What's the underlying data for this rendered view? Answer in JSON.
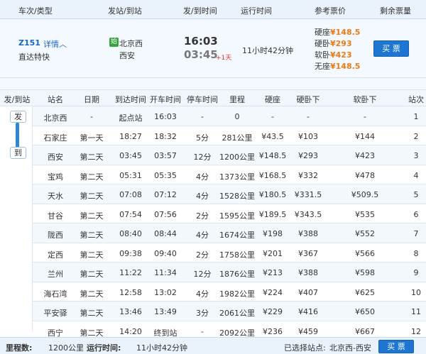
{
  "header": {
    "col_train": "车次/类型",
    "col_station": "发站/到站",
    "col_time": "发/到时间",
    "col_duration": "运行时间",
    "col_price": "参考票价",
    "col_remaining": "剩余票量"
  },
  "train": {
    "code": "Z151",
    "detail_link": "详情",
    "type": "直达特快",
    "start_badge": "始",
    "from_station": "北京西",
    "to_station": "西安",
    "depart_time": "16:03",
    "arrive_time": "03:45",
    "day_offset": "+1天",
    "duration": "11小时42分钟",
    "prices": [
      {
        "label": "硬座",
        "value": "¥148.5"
      },
      {
        "label": "硬卧",
        "value": "¥293"
      },
      {
        "label": "软卧",
        "value": "¥423"
      },
      {
        "label": "无座",
        "value": "¥148.5"
      }
    ],
    "buy_label": "买 票"
  },
  "table": {
    "headers": [
      "发/到站",
      "站名",
      "日期",
      "到达时间",
      "开车时间",
      "停车时间",
      "里程",
      "硬座",
      "硬卧下",
      "软卧下",
      "站次"
    ],
    "tag_depart": "发",
    "tag_arrive": "到",
    "rows": [
      [
        "北京西",
        "-",
        "起点站",
        "16:03",
        "-",
        "0",
        "-",
        "-",
        "-",
        "1"
      ],
      [
        "石家庄",
        "第一天",
        "18:27",
        "18:32",
        "5分",
        "281公里",
        "¥43.5",
        "¥103",
        "¥144",
        "2"
      ],
      [
        "西安",
        "第二天",
        "03:45",
        "03:57",
        "12分",
        "1200公里",
        "¥148.5",
        "¥293",
        "¥423",
        "3"
      ],
      [
        "宝鸡",
        "第二天",
        "05:31",
        "05:35",
        "4分",
        "1373公里",
        "¥168.5",
        "¥332",
        "¥478",
        "4"
      ],
      [
        "天水",
        "第二天",
        "07:08",
        "07:12",
        "4分",
        "1528公里",
        "¥180.5",
        "¥331.5",
        "¥509.5",
        "5"
      ],
      [
        "甘谷",
        "第二天",
        "07:54",
        "07:56",
        "2分",
        "1595公里",
        "¥189.5",
        "¥343.5",
        "¥535",
        "6"
      ],
      [
        "陇西",
        "第二天",
        "08:40",
        "08:44",
        "4分",
        "1674公里",
        "¥198",
        "¥388",
        "¥552",
        "7"
      ],
      [
        "定西",
        "第二天",
        "09:38",
        "09:40",
        "2分",
        "1758公里",
        "¥201",
        "¥367",
        "¥566",
        "8"
      ],
      [
        "兰州",
        "第二天",
        "11:22",
        "11:34",
        "12分",
        "1876公里",
        "¥213",
        "¥388",
        "¥598",
        "9"
      ],
      [
        "海石湾",
        "第二天",
        "12:58",
        "13:02",
        "4分",
        "1982公里",
        "¥224",
        "¥407",
        "¥625",
        "10"
      ],
      [
        "平安驿",
        "第二天",
        "13:46",
        "13:49",
        "3分",
        "2061公里",
        "¥229",
        "¥416",
        "¥650",
        "11"
      ],
      [
        "西宁",
        "第二天",
        "14:20",
        "终到站",
        "-",
        "2092公里",
        "¥236",
        "¥459",
        "¥667",
        "12"
      ]
    ]
  },
  "footer": {
    "mileage_label": "里程数:",
    "mileage_value": "1200公里",
    "runtime_label": "运行时间:",
    "runtime_value": "11小时42分钟",
    "selected_label": "已选择站点:",
    "selected_value": "北京西-西安",
    "buy_label": "买 票"
  },
  "colors": {
    "accent": "#1f76d2",
    "price": "#f07a16",
    "header_bg": "#eaf2fb"
  }
}
